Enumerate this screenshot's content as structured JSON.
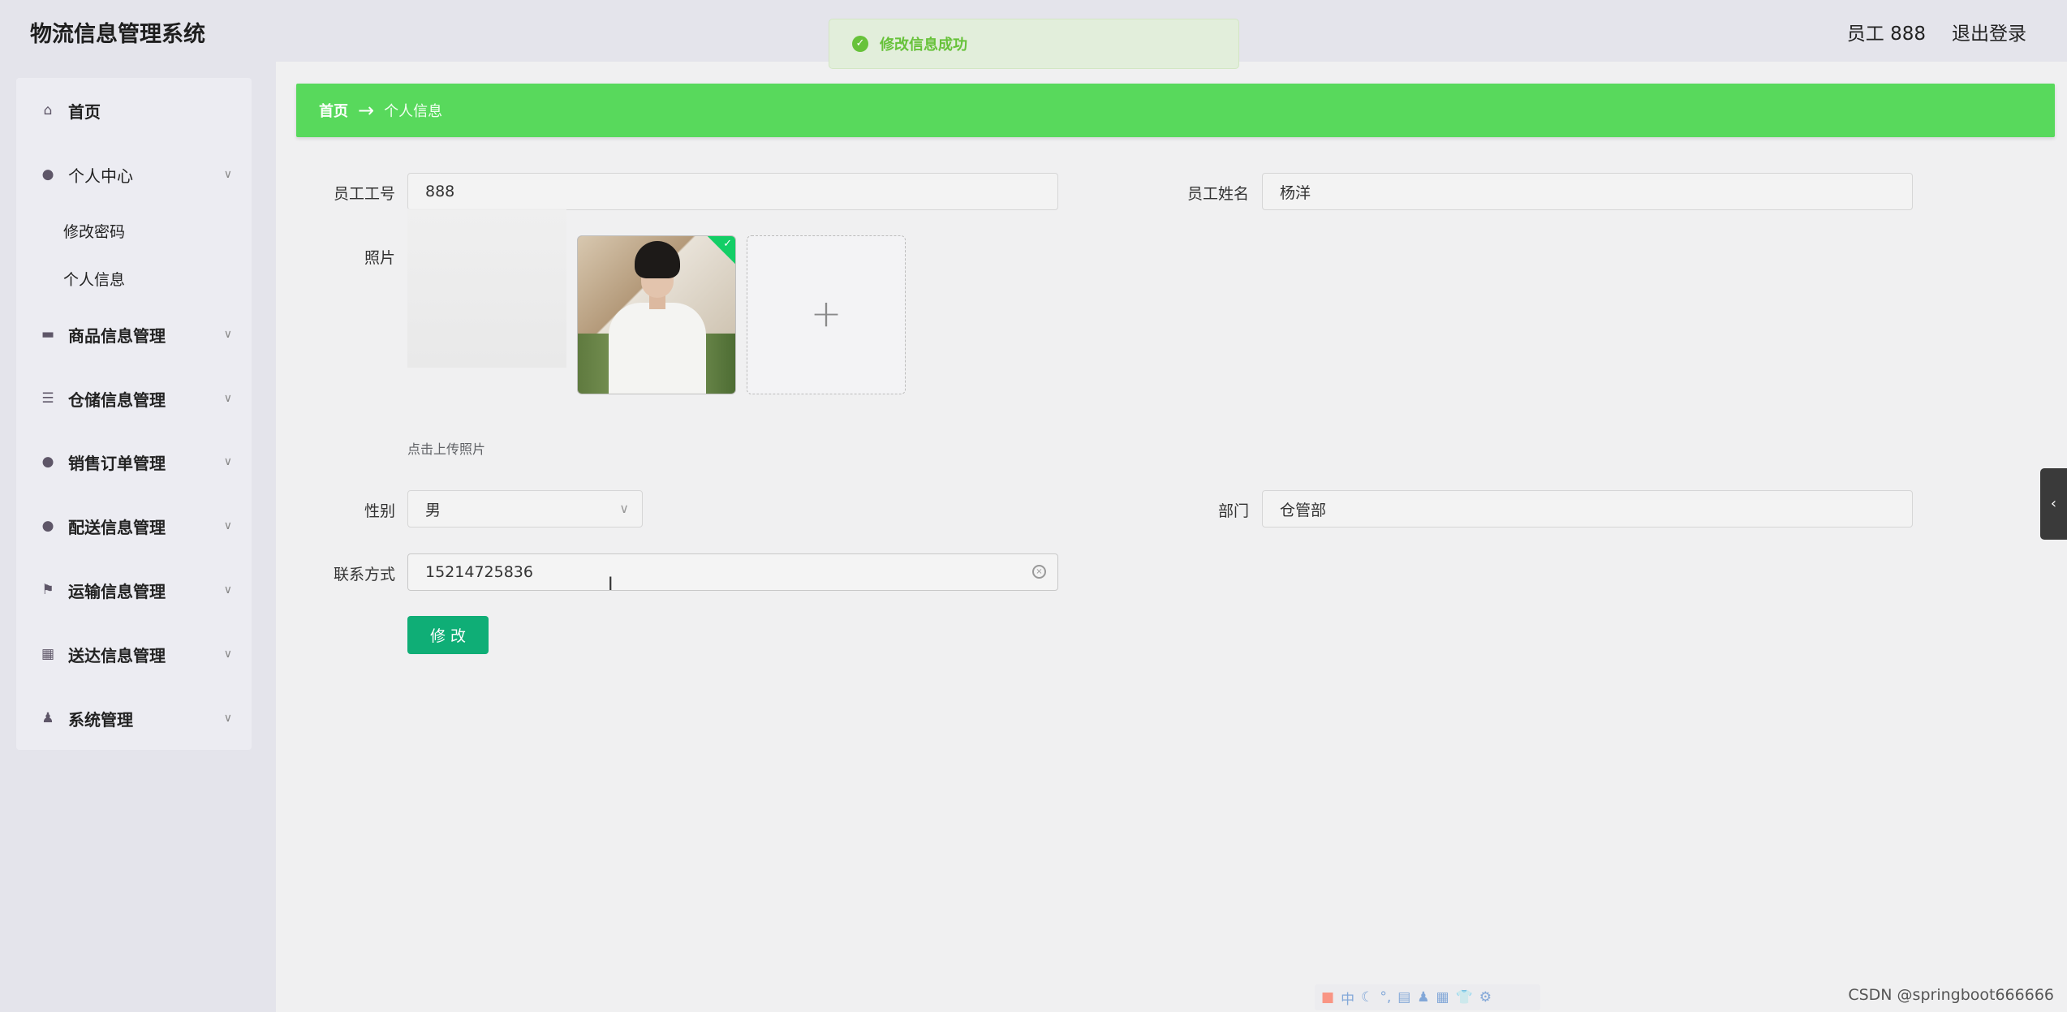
{
  "app_title": "物流信息管理系统",
  "header": {
    "user_label": "员工 888",
    "logout_label": "退出登录"
  },
  "toast": {
    "message": "修改信息成功"
  },
  "sidebar": {
    "items": [
      {
        "label": "首页",
        "icon": "home-icon"
      },
      {
        "label": "个人中心",
        "icon": "user-icon",
        "expanded": true
      },
      {
        "label": "商品信息管理",
        "icon": "chat-icon"
      },
      {
        "label": "仓储信息管理",
        "icon": "sliders-icon"
      },
      {
        "label": "销售订单管理",
        "icon": "location-icon"
      },
      {
        "label": "配送信息管理",
        "icon": "user-icon"
      },
      {
        "label": "运输信息管理",
        "icon": "flag-icon"
      },
      {
        "label": "送达信息管理",
        "icon": "grid-icon"
      },
      {
        "label": "系统管理",
        "icon": "stamp-icon"
      }
    ],
    "sub_items": [
      {
        "label": "修改密码"
      },
      {
        "label": "个人信息"
      }
    ]
  },
  "breadcrumb": {
    "home": "首页",
    "separator": "→",
    "current": "个人信息"
  },
  "form": {
    "emp_no": {
      "label": "员工工号",
      "value": "888"
    },
    "emp_name": {
      "label": "员工姓名",
      "value": "杨洋"
    },
    "photo": {
      "label": "照片",
      "hint": "点击上传照片"
    },
    "gender": {
      "label": "性别",
      "value": "男"
    },
    "dept": {
      "label": "部门",
      "value": "仓管部"
    },
    "contact": {
      "label": "联系方式",
      "value": "15214725836"
    },
    "submit_label": "修 改"
  },
  "ime": {
    "chars": [
      "中",
      "☾",
      "°,",
      "▤",
      "♟",
      "▦",
      "👕",
      "⚙"
    ]
  },
  "watermark": "CSDN @springboot666666"
}
